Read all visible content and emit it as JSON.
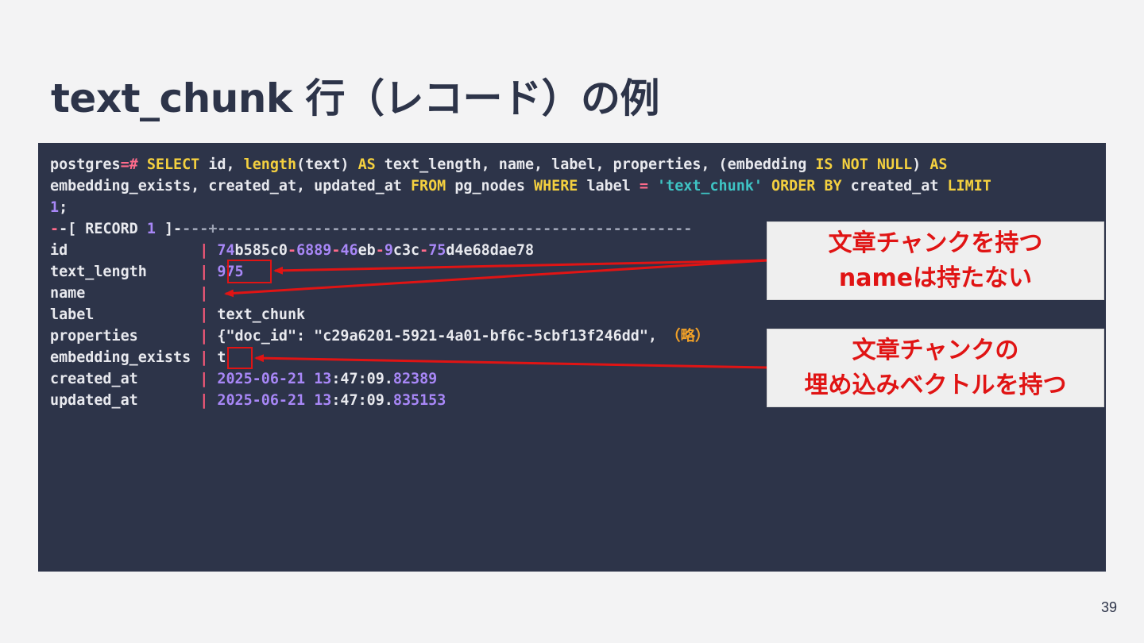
{
  "title": "text_chunk 行（レコード）の例",
  "page_number": "39",
  "terminal": {
    "prompt": "postgres=#",
    "query": {
      "select": "SELECT",
      "c1": " id, ",
      "fn_length": "length",
      "c2": "(text) ",
      "as1": "AS",
      "c3": " text_length, name, label, properties, (embedding ",
      "is": "IS",
      "not": "NOT",
      "null": "NULL",
      "c4": ") ",
      "as2": "AS",
      "line2_a": "embedding_exists, created_at, updated_at ",
      "from": "FROM",
      "line2_b": " pg_nodes ",
      "where": "WHERE",
      "line2_c": " label ",
      "eq": "=",
      "literal": "'text_chunk'",
      "order": "ORDER",
      "by": "BY",
      "line2_d": " created_at ",
      "limit": "LIMIT",
      "limit_value": "1",
      "semicolon": ";"
    },
    "record_header": {
      "prefix": "-[ RECORD ",
      "number": "1",
      "suffix": " ]-",
      "rule": "---+------------------------------------------------------"
    },
    "rows": [
      {
        "field": "id              ",
        "value_parts": [
          "74",
          "b585c0",
          "-",
          "6889",
          "-",
          "46",
          "eb",
          "-",
          "9",
          "c3c",
          "-",
          "75",
          "d4e68dae78"
        ]
      },
      {
        "field": "text_length     ",
        "value": "975"
      },
      {
        "field": "name            ",
        "value": ""
      },
      {
        "field": "label           ",
        "value": "text_chunk"
      },
      {
        "field": "properties      ",
        "value": "{\"doc_id\": \"c29a6201-5921-4a01-bf6c-5cbf13f246dd\",",
        "note": "（略）"
      },
      {
        "field": "embedding_exists",
        "value": "t"
      },
      {
        "field": "created_at      ",
        "date": "2025-06-21",
        "h": "13",
        "ms": ":47:09.",
        "frac": "82389"
      },
      {
        "field": "updated_at      ",
        "date": "2025-06-21",
        "h": "13",
        "ms": ":47:09.",
        "frac": "835153"
      }
    ]
  },
  "callouts": [
    {
      "lines": [
        "文章チャンクを持つ",
        "nameは持たない"
      ]
    },
    {
      "lines": [
        "文章チャンクの",
        "埋め込みベクトルを持つ"
      ]
    }
  ],
  "colors": {
    "background": "#f3f3f4",
    "terminal_bg": "#2d3449",
    "keyword": "#f4d03f",
    "number": "#a887f7",
    "string": "#3ec4c4",
    "pipe": "#ff5a7a",
    "annotation_red": "#e01414"
  }
}
